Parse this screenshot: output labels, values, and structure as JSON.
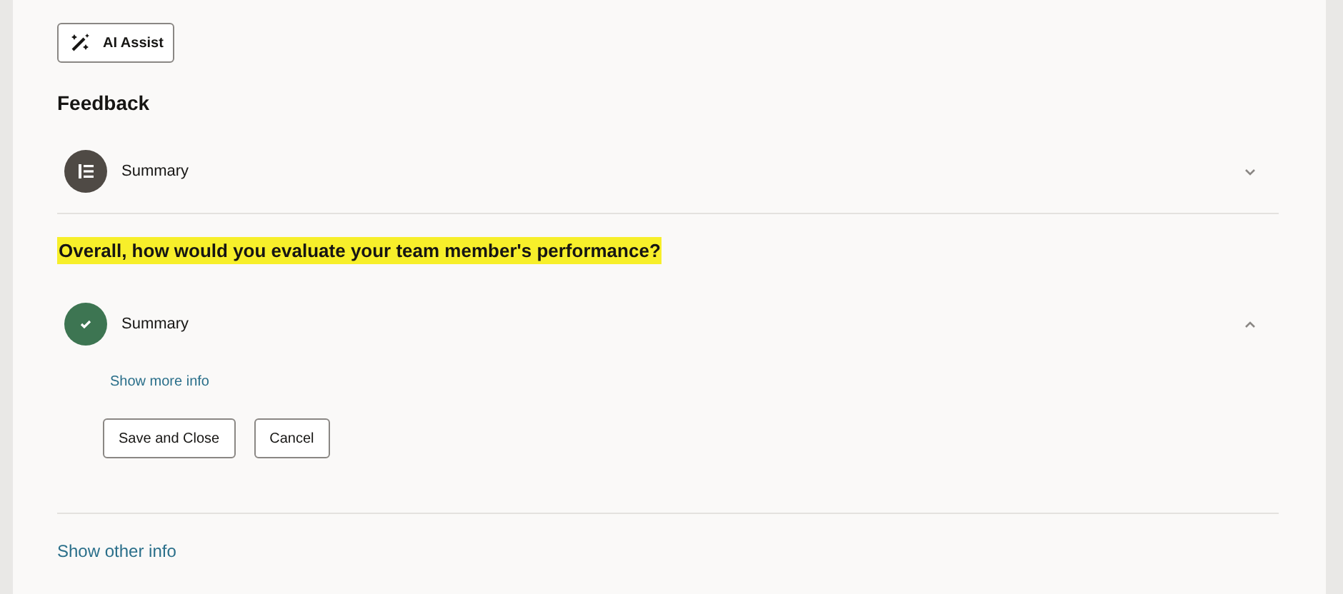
{
  "ai_assist_button": "AI Assist",
  "heading": "Feedback",
  "items": [
    {
      "kind": "accordion",
      "complete": false,
      "label": "Summary",
      "expanded": false
    },
    {
      "kind": "question",
      "text": "Overall, how would you evaluate your team member's performance?",
      "highlighted": true
    },
    {
      "kind": "accordion",
      "complete": true,
      "label": "Summary",
      "expanded": true,
      "link": "Show more info",
      "buttons": [
        "Save and Close",
        "Cancel"
      ]
    }
  ],
  "footer_link": "Show other info"
}
